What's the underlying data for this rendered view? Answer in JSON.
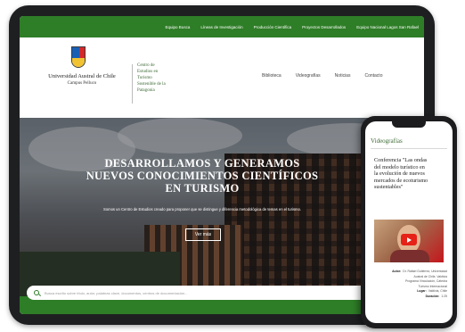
{
  "tablet": {
    "topnav": [
      "Equipo Busca",
      "Líneas de Investigación",
      "Producción Científica",
      "Proyectos Desarrollados",
      "Equipo Nacional Lagos San Rafael"
    ],
    "university": {
      "name": "Universidad Austral de Chile",
      "campus": "Campus Pelluco"
    },
    "center_name": [
      "Centro de",
      "Estudios en",
      "Turismo",
      "Sostenible de la",
      "Patagonia"
    ],
    "mainnav": [
      "Biblioteca",
      "Videografías",
      "Noticias",
      "Contacto"
    ],
    "hero": {
      "title": [
        "DESARROLLAMOS Y GENERAMOS",
        "NUEVOS CONOCIMIENTOS CIENTÍFICOS",
        "EN TURISMO"
      ],
      "subtitle": "Somos un Centro de Estudios creado para proponer que se distingue y diferencia metodológica de temas en el turismo.",
      "button": "Ver más"
    },
    "search_placeholder": "Busca escrito sobre título, autor, palabras clave, documentos, centros de documentación..."
  },
  "phone": {
    "section": "Videografías",
    "article_title": [
      "Conferencia \"Las ondas",
      "del modelo turístico en",
      "la evolución de nuevos",
      "mercados de ecoturismo",
      "sustentables\""
    ],
    "meta": [
      {
        "label": "Autor:",
        "value": "Dr. Rafael Gutiérrez, Universidad"
      },
      {
        "label": "",
        "value": "Austral de Chile, Valdivia"
      },
      {
        "label": "",
        "value": "Programa Vinculación, Cátedra"
      },
      {
        "label": "",
        "value": "Turismo Internacional"
      },
      {
        "label": "Lugar:",
        "value": "Valdivia, Chile"
      },
      {
        "label": "Duración:",
        "value": "1:25"
      }
    ]
  },
  "colors": {
    "accent_green": "#2e7d27",
    "youtube_red": "#e62117"
  }
}
